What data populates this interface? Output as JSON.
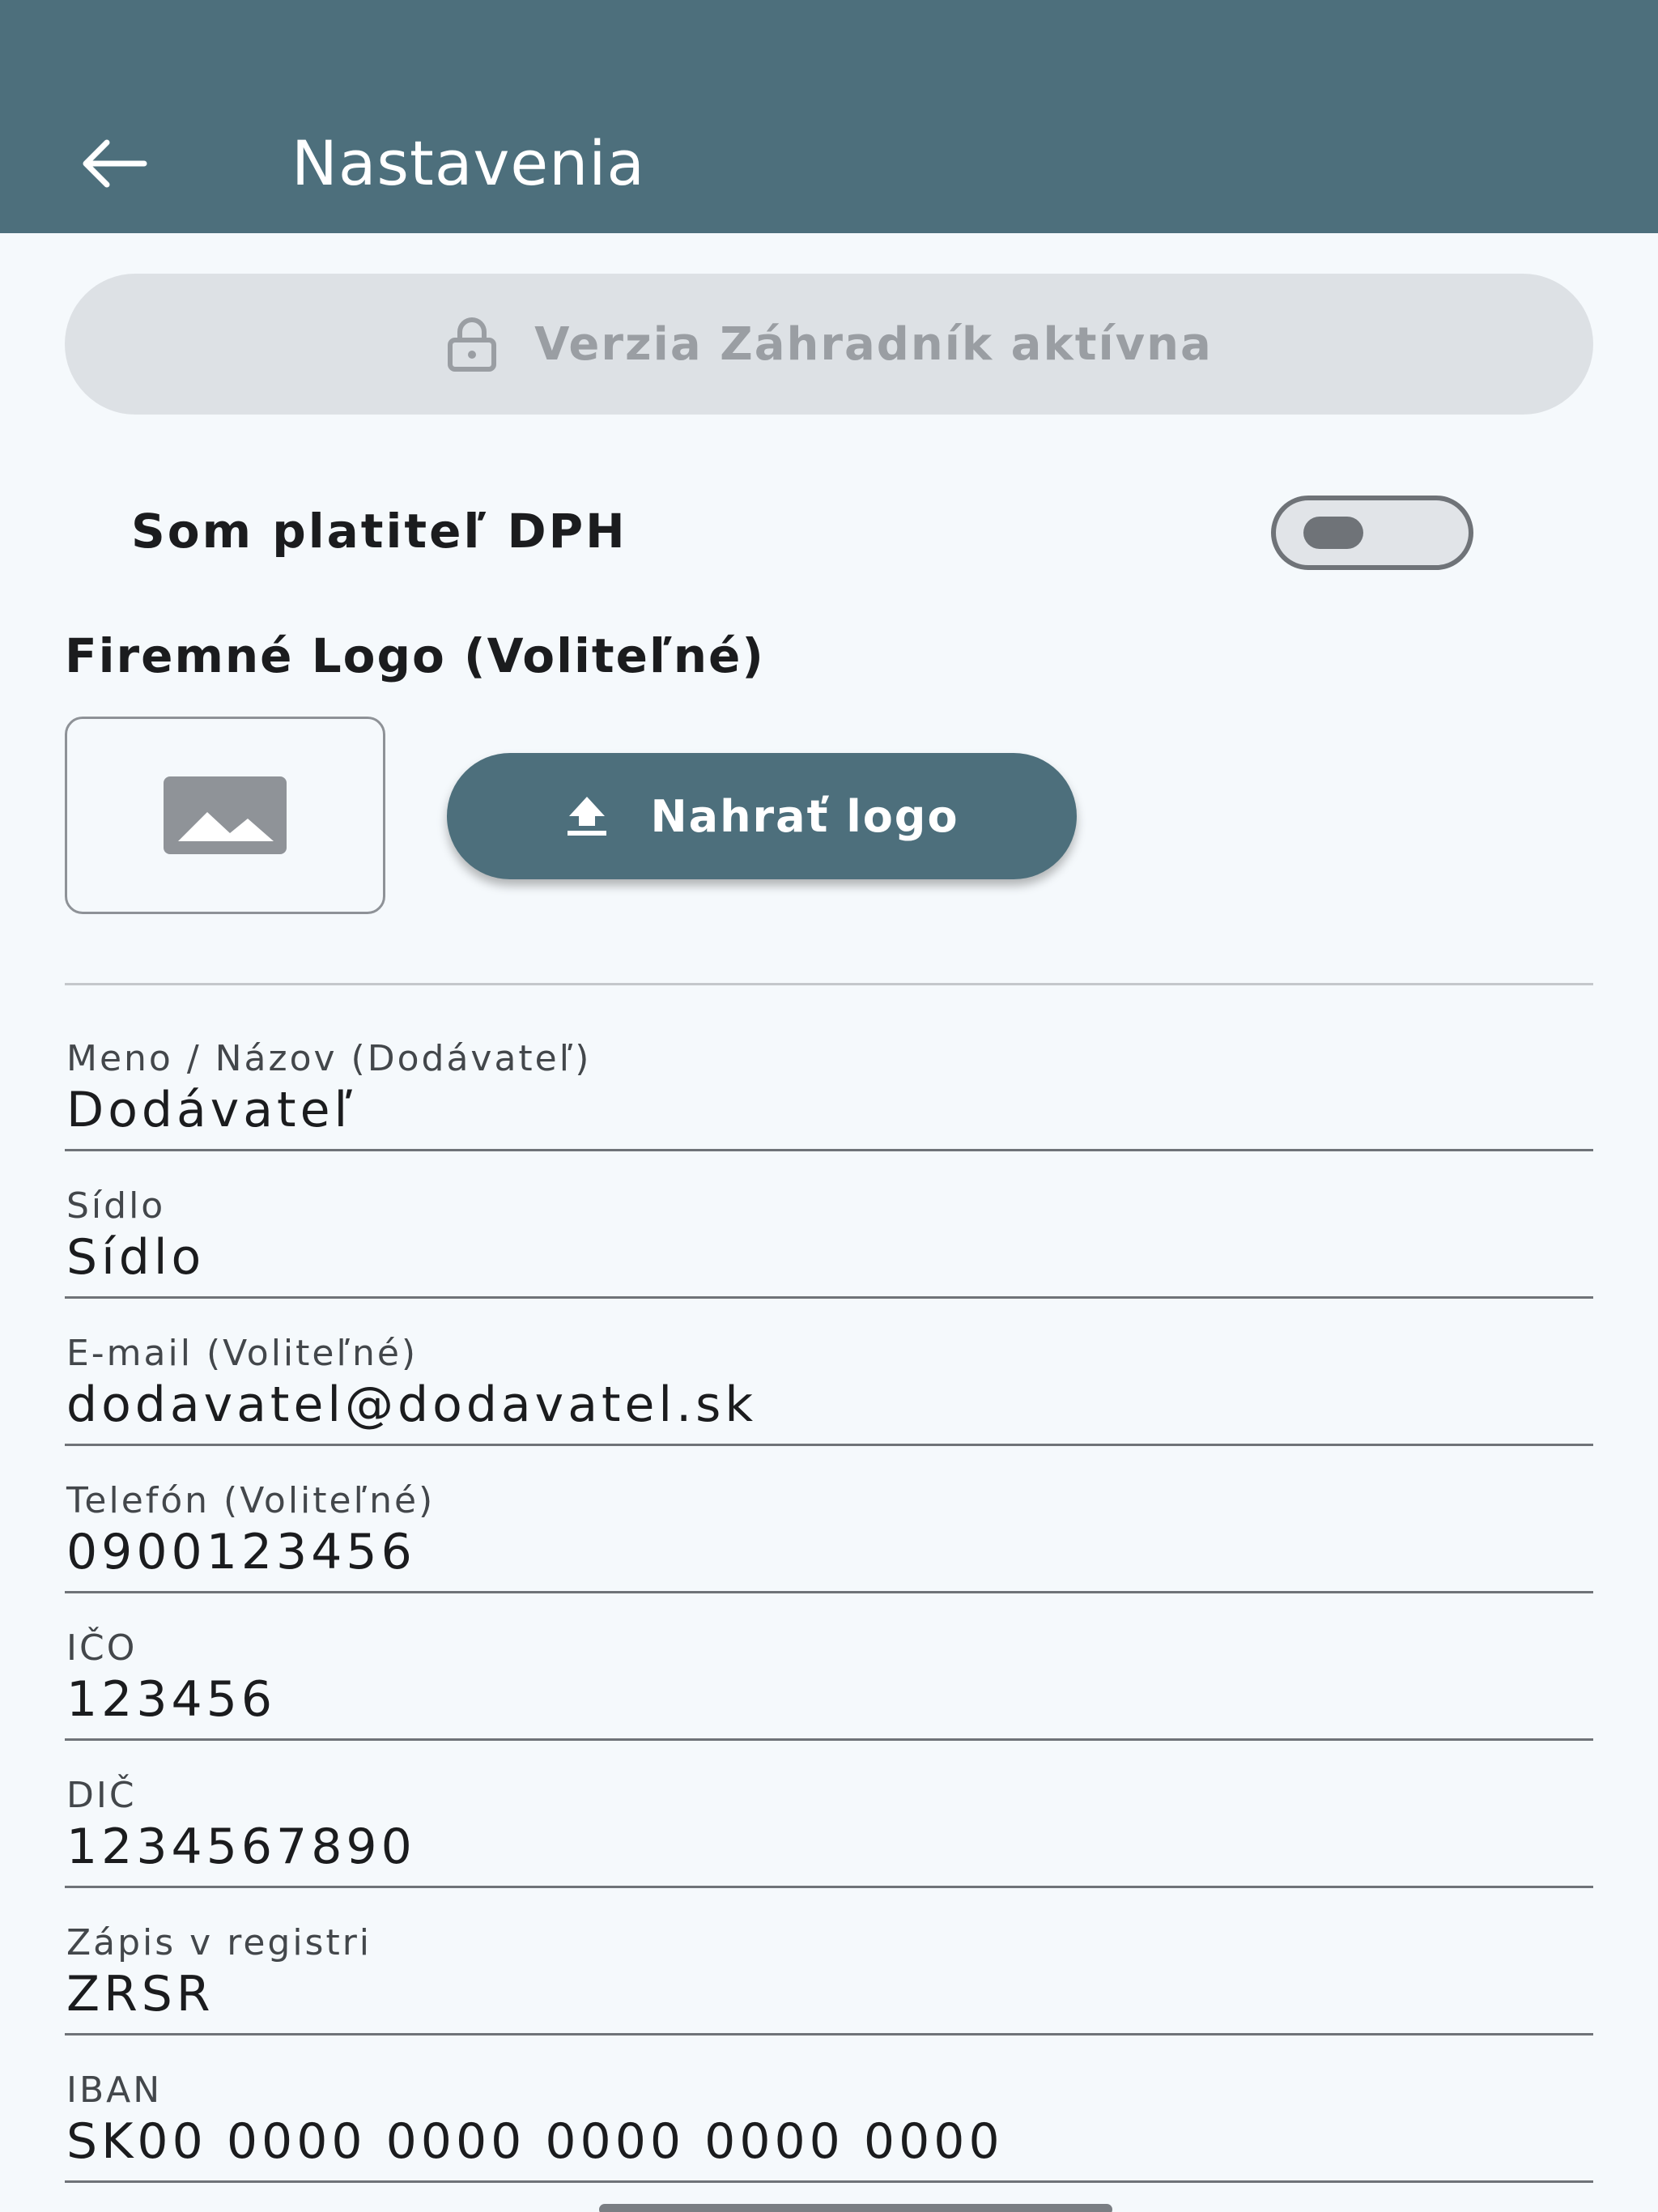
{
  "appbar": {
    "title": "Nastavenia"
  },
  "banner": {
    "label": "Verzia Záhradník aktívna"
  },
  "vat": {
    "label": "Som platiteľ DPH",
    "enabled": false
  },
  "logo": {
    "title": "Firemné Logo (Voliteľné)",
    "upload_label": "Nahrať logo"
  },
  "fields": [
    {
      "label": "Meno / Názov (Dodávateľ)",
      "value": "Dodávateľ"
    },
    {
      "label": "Sídlo",
      "value": "Sídlo"
    },
    {
      "label": "E-mail (Voliteľné)",
      "value": "dodavatel@dodavatel.sk"
    },
    {
      "label": "Telefón (Voliteľné)",
      "value": "0900123456"
    },
    {
      "label": "IČO",
      "value": "123456"
    },
    {
      "label": "DIČ",
      "value": "1234567890"
    },
    {
      "label": "Zápis v registri",
      "value": "ZRSR"
    },
    {
      "label": "IBAN",
      "value": "SK00 0000 0000 0000 0000 0000"
    }
  ],
  "colors": {
    "appbar": "#4d6f7c",
    "background": "#f5f9fc",
    "banner": "#dde1e5",
    "primary_button": "#4d6f7c"
  },
  "icons": {
    "back": "arrow-left-icon",
    "lock": "lock-icon",
    "image_placeholder": "image-icon",
    "upload": "upload-icon"
  }
}
